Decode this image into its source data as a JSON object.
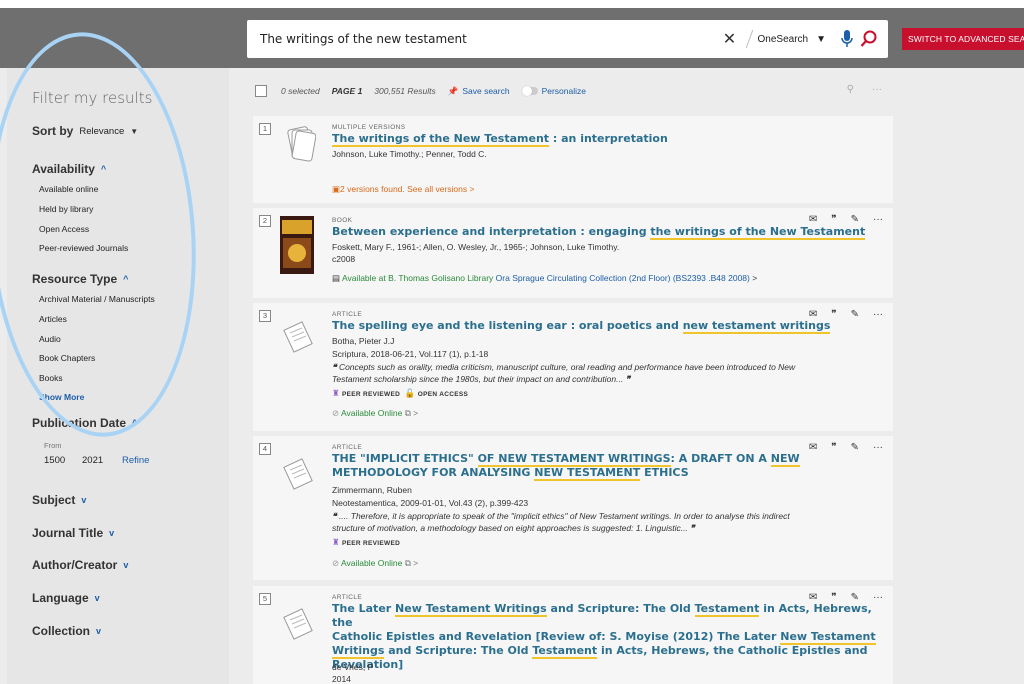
{
  "header": {
    "search_value": "The writings of the new testament",
    "scope": "OneSearch",
    "advanced_label": "SWITCH TO ADVANCED SEARCH"
  },
  "sidebar": {
    "title": "Filter my results",
    "sort_label": "Sort by",
    "sort_value": "Relevance",
    "availability": {
      "label": "Availability",
      "items": [
        "Available online",
        "Held by library",
        "Open Access",
        "Peer-reviewed Journals"
      ]
    },
    "resource_type": {
      "label": "Resource Type",
      "items": [
        "Archival Material / Manuscripts",
        "Articles",
        "Audio",
        "Book Chapters",
        "Books"
      ],
      "show_more": "Show More"
    },
    "publication_date": {
      "label": "Publication Date",
      "from_label": "From",
      "from": "1500",
      "to": "2021",
      "refine": "Refine"
    },
    "collapsed": [
      "Subject",
      "Journal Title",
      "Author/Creator",
      "Language",
      "Collection"
    ]
  },
  "results_header": {
    "selected": "0 selected",
    "page": "PAGE 1",
    "count": "300,551 Results",
    "save": "Save search",
    "personalize": "Personalize"
  },
  "results": [
    {
      "num": "1",
      "type": "MULTIPLE VERSIONS",
      "title_pre": "",
      "title_hl": "The writings of the New Testament",
      "title_post": " : an interpretation",
      "authors": "Johnson, Luke Timothy.; Penner, Todd C.",
      "versions": "2 versions found. See all versions",
      "chevron": ">"
    },
    {
      "num": "2",
      "type": "BOOK",
      "title_pre": "Between experience and interpretation : engaging ",
      "title_hl": "the writings of the New Testament",
      "authors": "Foskett, Mary F., 1961-; Allen, O. Wesley, Jr., 1965-; Johnson, Luke Timothy.",
      "date": "c2008",
      "avail_pre": "Available at B. Thomas Golisano Library",
      "avail_loc": "Ora Sprague Circulating Collection (2nd Floor) (BS2393 .B48 2008)",
      "chevron": ">"
    },
    {
      "num": "3",
      "type": "ARTICLE",
      "title_pre": "The spelling eye and the listening ear : oral poetics and ",
      "title_hl": "new testament writings",
      "authors": "Botha, Pieter J.J",
      "source": "Scriptura, 2018-06-21, Vol.117 (1), p.1-18",
      "snippet1": "Concepts such as orality, media criticism, manuscript culture, oral reading and performance have been introduced to New",
      "snippet2": "Testament scholarship since the 1980s, but their impact on and contribution...",
      "badge_peer": "PEER REVIEWED",
      "badge_oa": "OPEN ACCESS",
      "online": "Available Online",
      "chevron": ">"
    },
    {
      "num": "4",
      "type": "ARTICLE",
      "title_l1_pre": "THE \"IMPLICIT ETHICS\" ",
      "title_l1_hl": "OF NEW TESTAMENT WRITINGS",
      "title_l1_post": ": A DRAFT ON A ",
      "title_l1_hl2": "NEW",
      "title_l2_pre": "METHODOLOGY FOR ANALYSING ",
      "title_l2_hl": "NEW TESTAMENT",
      "title_l2_post": " ETHICS",
      "authors": "Zimmermann, Ruben",
      "source": "Neotestamentica, 2009-01-01, Vol.43 (2), p.399-423",
      "snippet1": ".... Therefore, it is appropriate to speak of the \"implicit ethics\" of New Testament writings. In order to analyse this indirect",
      "snippet2": "structure of motivation, a methodology based on eight approaches is suggested: 1. Linguistic...",
      "badge_peer": "PEER REVIEWED",
      "online": "Available Online",
      "chevron": ">"
    },
    {
      "num": "5",
      "type": "ARTICLE",
      "title_l1_pre": "The Later ",
      "title_l1_hl": "New Testament Writings",
      "title_l1_post": " and Scripture: The Old ",
      "title_l1_hl2": "Testament",
      "title_l1_post2": " in Acts, Hebrews, the",
      "title_l2_pre": "Catholic Epistles and Revelation [Review of: S. Moyise (2012) The Later ",
      "title_l2_hl": "New Testament",
      "title_l3_hl": "Writings",
      "title_l3_post": " and Scripture: The Old ",
      "title_l3_hl2": "Testament",
      "title_l3_post2": " in Acts, Hebrews, the Catholic Epistles and",
      "title_l4": "Revelation]",
      "authors": "de Vries, P",
      "date": "2014"
    }
  ],
  "icons": {
    "actions": [
      "email-icon",
      "citation-icon",
      "pin-icon",
      "more-icon"
    ]
  },
  "colors": {
    "accent": "#c8102e",
    "link": "#2b6f8f",
    "highlight": "#f0c42b",
    "annotation": "#a9d3f5"
  }
}
